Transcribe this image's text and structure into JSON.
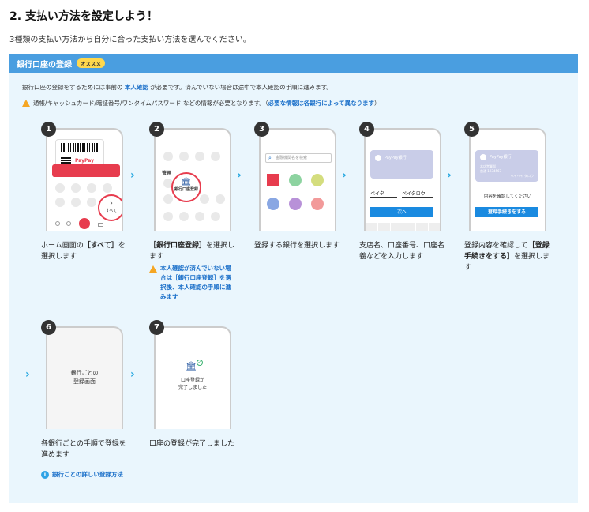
{
  "page": {
    "title": "2. 支払い方法を設定しよう！",
    "description": "3種類の支払い方法から自分に合った支払い方法を選んでください。"
  },
  "panel": {
    "title": "銀行口座の登録",
    "badge": "オススメ",
    "note1_a": "銀行口座の登録をするためには事前の",
    "note1_link": "本人確認",
    "note1_b": "が必要です。済んでいない場合は途中で本人確認の手順に進みます。",
    "note2_a": "通帳/キャッシュカード/暗証番号/ワンタイムパスワード などの情報が必要となります。（",
    "note2_link": "必要な情報は各銀行によって異なります",
    "note2_b": "）"
  },
  "steps": [
    {
      "num": "1",
      "cap_a": "ホーム画面の",
      "cap_b": "［すべて］",
      "cap_c": "を選択します",
      "screen": {
        "brand": "PayPay",
        "button": "すべて"
      }
    },
    {
      "num": "2",
      "cap_a": "",
      "cap_b": "［銀行口座登録］",
      "cap_c": "を選択します",
      "screen": {
        "section": "管理",
        "button": "銀行口座登録"
      },
      "warn": "本人確認が済んでいない場合は［銀行口座登録］を選択後、本人確認の手順に進みます"
    },
    {
      "num": "3",
      "cap_a": "登録する銀行を選択します",
      "cap_b": "",
      "cap_c": "",
      "screen": {
        "search_placeholder": "金融機関名を検索"
      }
    },
    {
      "num": "4",
      "cap_a": "支店名、口座番号、口座名義などを入力します",
      "cap_b": "",
      "cap_c": "",
      "screen": {
        "card_label": "PayPay銀行",
        "field1": "ペイタ",
        "field2": "ペイタロウ",
        "next": "次へ"
      }
    },
    {
      "num": "5",
      "cap_a": "登録内容を確認して",
      "cap_b": "［登録手続きをする］",
      "cap_c": "を選択します",
      "screen": {
        "card_label": "PayPay銀行",
        "card_line1": "本店営業部",
        "card_line2": "普通 1234567",
        "card_line3": "ペイペイ タロウ",
        "confirm": "内容を確認してください",
        "button": "登録手続きをする"
      }
    },
    {
      "num": "6",
      "cap_a": "各銀行ごとの手順で登録を進めます",
      "cap_b": "",
      "cap_c": "",
      "screen": {
        "text": "銀行ごとの\n登録画面"
      },
      "link": "銀行ごとの詳しい登録方法"
    },
    {
      "num": "7",
      "cap_a": "口座の登録が完了しました",
      "cap_b": "",
      "cap_c": "",
      "screen": {
        "text": "口座登録が\n完了しました"
      }
    }
  ],
  "colors": {
    "accent": "#4a9ee0",
    "arrow": "#25a7e0",
    "red": "#e73c4e",
    "link": "#1a6fc9"
  }
}
